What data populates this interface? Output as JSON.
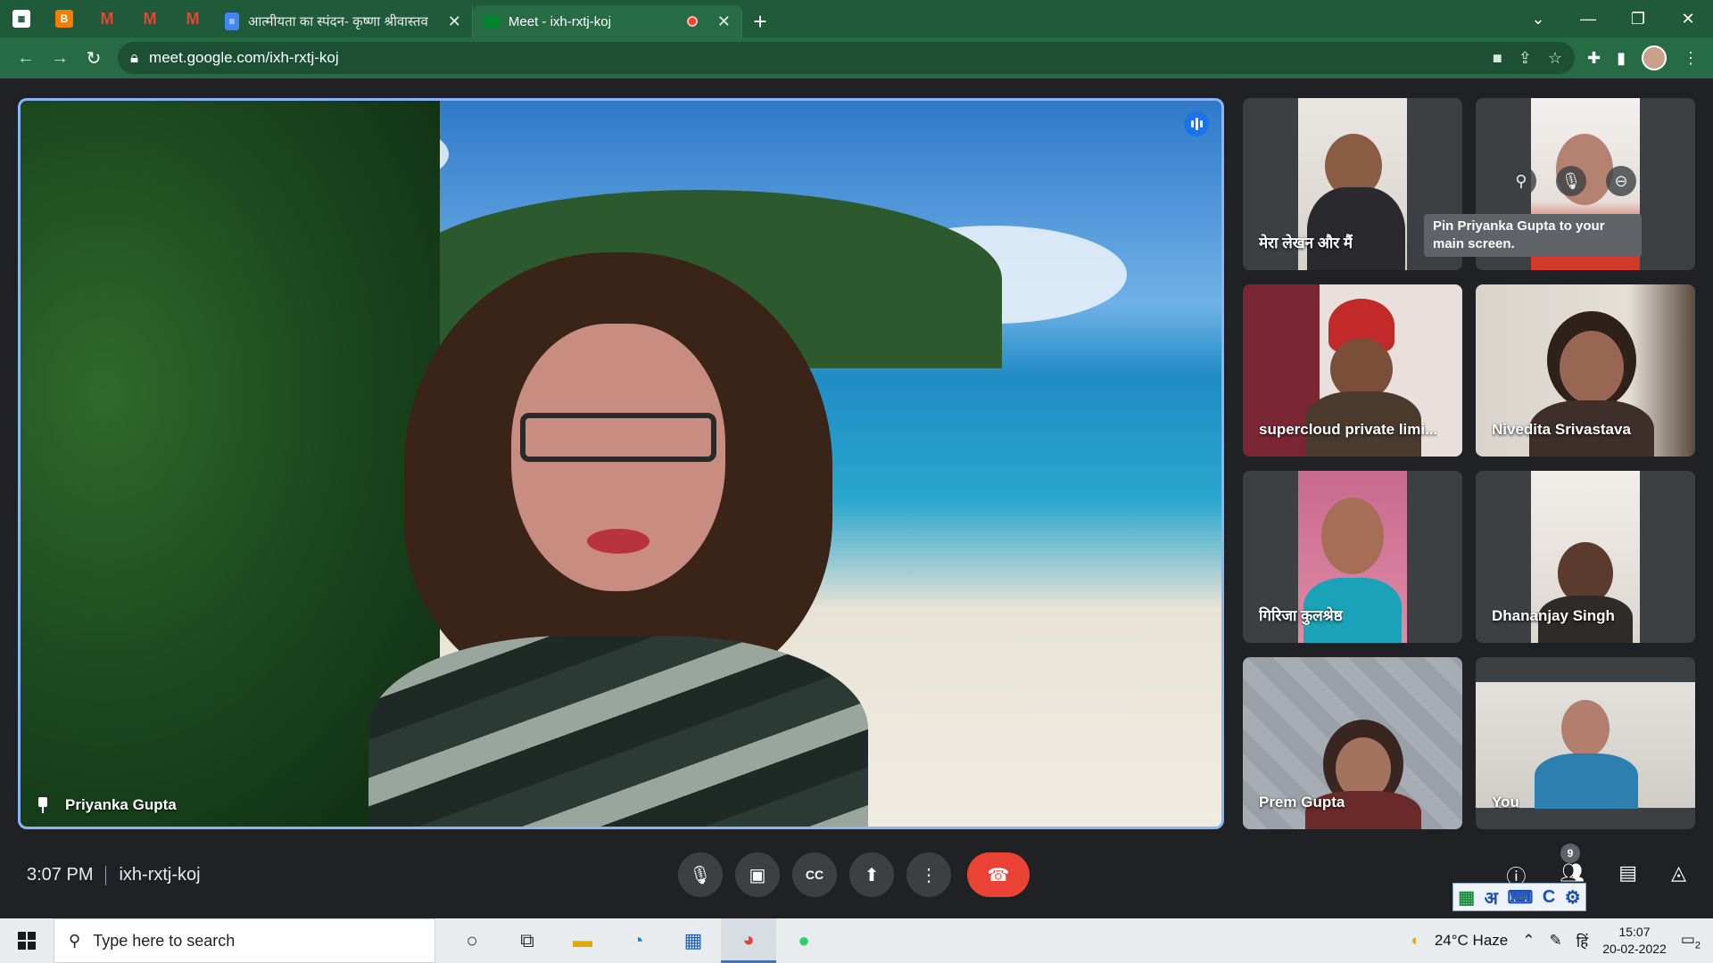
{
  "browser": {
    "tabs": [
      {
        "title": "आत्मीयता का स्पंदन- कृष्णा श्रीवास्तव",
        "favicon": "docs-icon",
        "active": false
      },
      {
        "title": "Meet - ixh-rxtj-koj",
        "favicon": "meet-icon",
        "active": true
      }
    ],
    "url": "meet.google.com/ixh-rxtj-koj"
  },
  "main_tile": {
    "name": "Priyanka Gupta"
  },
  "participants": [
    {
      "name": "मेरा लेखन और मैं"
    },
    {
      "name": ""
    },
    {
      "name": "supercloud private limi..."
    },
    {
      "name": "Nivedita Srivastava"
    },
    {
      "name": "गिरिजा कुलश्रेष्ठ"
    },
    {
      "name": "Dhananjay Singh"
    },
    {
      "name": "Prem Gupta"
    },
    {
      "name": "You"
    }
  ],
  "tooltip": "Pin Priyanka Gupta to your main screen.",
  "meeting": {
    "time": "3:07 PM",
    "code": "ixh-rxtj-koj",
    "participant_count": "9"
  },
  "ime": {
    "letter": "अ",
    "c": "C"
  },
  "taskbar": {
    "search_placeholder": "Type here to search",
    "weather": "24°C  Haze",
    "lang": "हिं",
    "time": "15:07",
    "date": "20-02-2022",
    "notifications": "2"
  }
}
